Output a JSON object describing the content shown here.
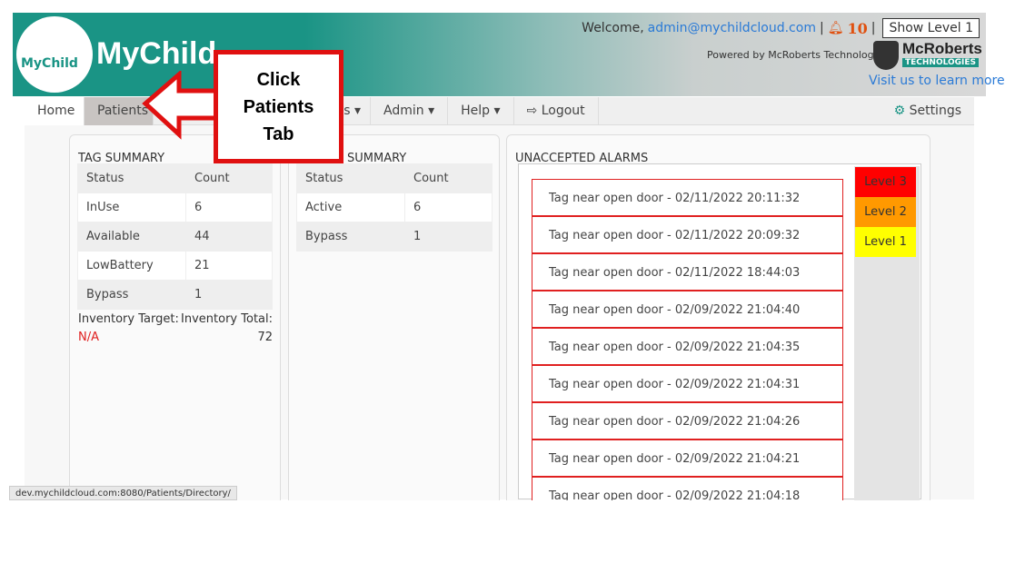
{
  "header": {
    "logo_small": "MyChild",
    "logo_text": "MyChild",
    "welcome": "Welcome,",
    "user": "admin@mychildcloud.com",
    "sep": "|",
    "alert_count": "10",
    "show_level": "Show Level 1",
    "powered": "Powered by McRoberts Technologies",
    "mcr_name": "McRoberts",
    "mcr_tech": "TECHNOLOGIES",
    "visit": "Visit us to learn more"
  },
  "nav": {
    "home": "Home",
    "patients": "Patients",
    "hidden": "s ▾",
    "admin": "Admin ▾",
    "help": "Help ▾",
    "logout": "Logout",
    "settings": "Settings"
  },
  "tag_summary": {
    "title": "TAG SUMMARY",
    "headers": [
      "Status",
      "Count"
    ],
    "rows": [
      [
        "InUse",
        "6"
      ],
      [
        "Available",
        "44"
      ],
      [
        "LowBattery",
        "21"
      ],
      [
        "Bypass",
        "1"
      ]
    ],
    "target_label": "Inventory Target:",
    "target_value": "N/A",
    "total_label": "Inventory Total:",
    "total_value": "72"
  },
  "second_summary": {
    "title": "SUMMARY",
    "headers": [
      "Status",
      "Count"
    ],
    "rows": [
      [
        "Active",
        "6"
      ],
      [
        "Bypass",
        "1"
      ]
    ]
  },
  "alarms": {
    "title": "UNACCEPTED ALARMS",
    "levels": [
      {
        "label": "Level 3",
        "color": "#ff0000"
      },
      {
        "label": "Level 2",
        "color": "#ff9900"
      },
      {
        "label": "Level 1",
        "color": "#ffff00"
      }
    ],
    "items": [
      "Tag near open door - 02/11/2022 20:11:32",
      "Tag near open door - 02/11/2022 20:09:32",
      "Tag near open door - 02/11/2022 18:44:03",
      "Tag near open door - 02/09/2022 21:04:40",
      "Tag near open door - 02/09/2022 21:04:35",
      "Tag near open door - 02/09/2022 21:04:31",
      "Tag near open door - 02/09/2022 21:04:26",
      "Tag near open door - 02/09/2022 21:04:21",
      "Tag near open door - 02/09/2022 21:04:18"
    ]
  },
  "status_url": "dev.mychildcloud.com:8080/Patients/Directory/",
  "callout": {
    "line1": "Click",
    "line2": "Patients",
    "line3": "Tab"
  }
}
